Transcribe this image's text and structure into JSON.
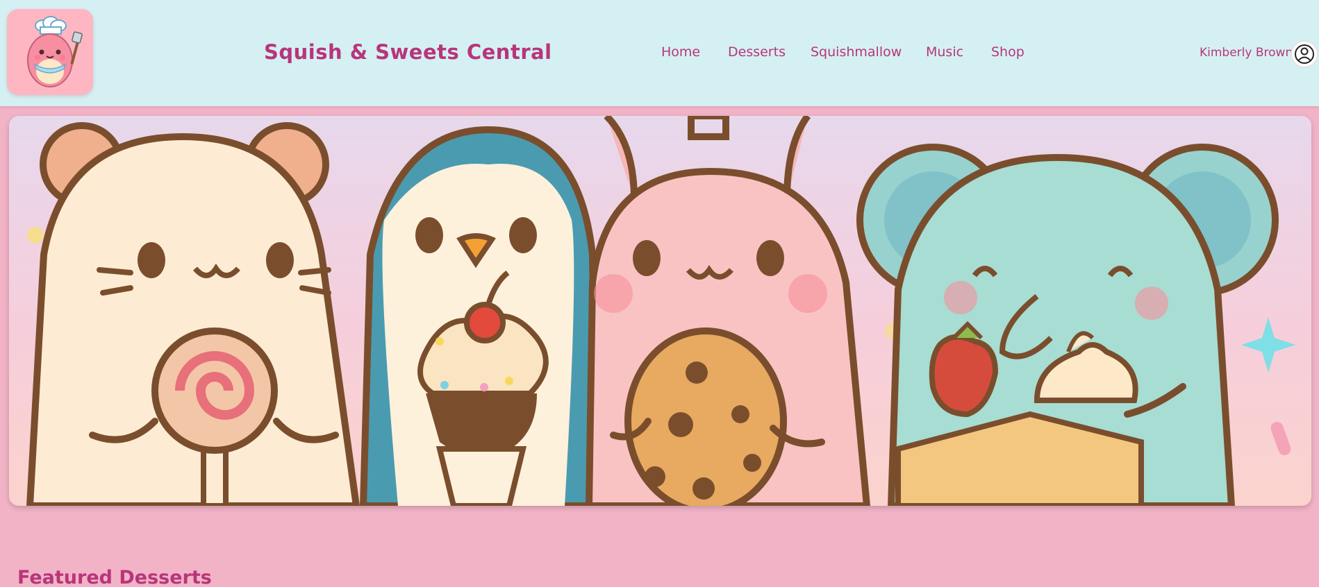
{
  "site": {
    "title": "Squish & Sweets Central"
  },
  "nav": {
    "items": [
      {
        "label": "Home"
      },
      {
        "label": "Desserts"
      },
      {
        "label": "Squishmallow"
      },
      {
        "label": "Music"
      },
      {
        "label": "Shop"
      }
    ]
  },
  "user": {
    "name": "Kimberly Brown",
    "avatar_icon": "user-circle-icon"
  },
  "logo": {
    "icon": "chef-squishmallow-logo"
  },
  "hero": {
    "image": "squishmallows-with-desserts-banner"
  },
  "featured": {
    "title": "Featured Desserts"
  },
  "colors": {
    "header_bg": "#d5f0f3",
    "page_bg": "#f2b3c6",
    "accent": "#b8357b"
  }
}
